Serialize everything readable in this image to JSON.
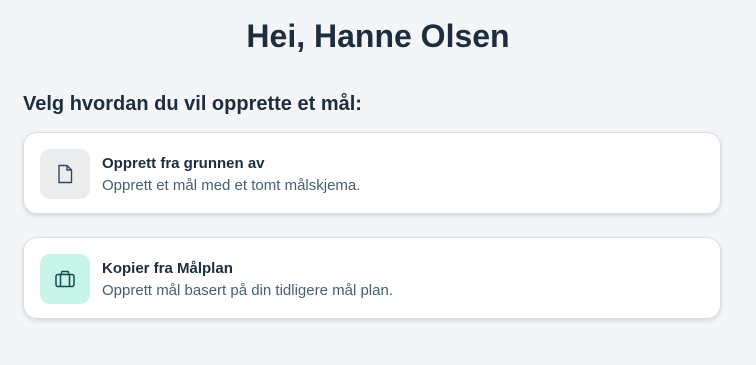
{
  "greeting": "Hei, Hanne Olsen",
  "prompt": "Velg hvordan du vil opprette et mål:",
  "options": [
    {
      "title": "Opprett fra grunnen av",
      "description": "Opprett et mål med et tomt målskjema.",
      "icon": "document-icon",
      "icon_bg": "#eaecee"
    },
    {
      "title": "Kopier fra Målplan",
      "description": "Opprett mål basert på din tidligere mål plan.",
      "icon": "briefcase-icon",
      "icon_bg": "#c8f4ea"
    }
  ]
}
